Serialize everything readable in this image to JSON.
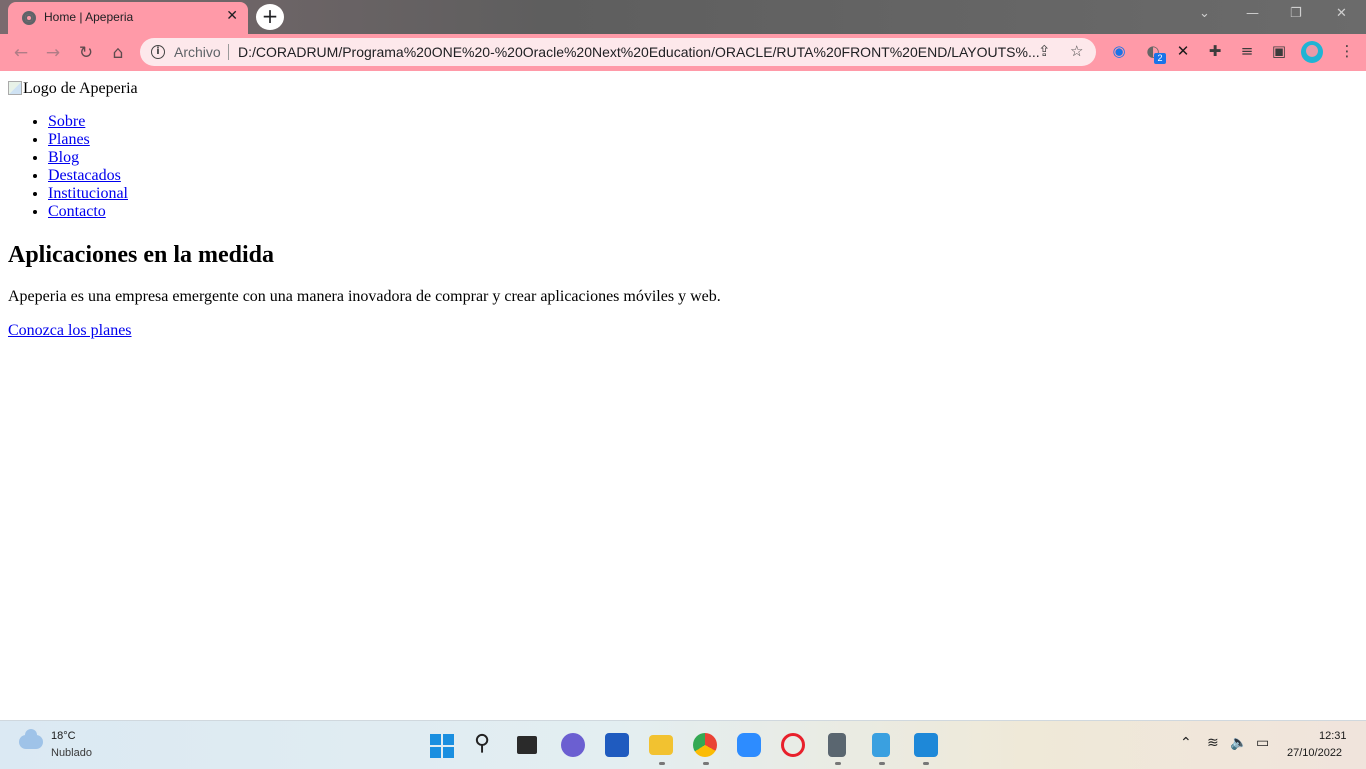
{
  "browser": {
    "tab_title": "Home | Apeperia",
    "new_tab_label": "+",
    "close_tab_label": "✕",
    "address": {
      "scheme_label": "Archivo",
      "url": "D:/CORADRUM/Programa%20ONE%20-%20Oracle%20Next%20Education/ORACLE/RUTA%20FRONT%20END/LAYOUTS%..."
    },
    "extensions_badge": "2",
    "colors": {
      "accent": "#ff9aa8",
      "link": "#0000ee"
    }
  },
  "page": {
    "logo_alt": "Logo de Apeperia",
    "nav_items": [
      {
        "label": "Sobre"
      },
      {
        "label": "Planes"
      },
      {
        "label": "Blog"
      },
      {
        "label": "Destacados"
      },
      {
        "label": "Institucional"
      },
      {
        "label": "Contacto"
      }
    ],
    "headline": "Aplicaciones en la medida",
    "description": "Apeperia es una empresa emergente con una manera inovadora de comprar y crear aplicaciones móviles y web.",
    "cta_label": "Conozca los planes"
  },
  "taskbar": {
    "weather": {
      "temperature": "18°C",
      "condition": "Nublado"
    },
    "clock": {
      "time": "12:31",
      "date": "27/10/2022"
    },
    "apps": [
      "windows-start",
      "search",
      "task-view",
      "teams-chat",
      "word",
      "file-explorer",
      "chrome",
      "zoom",
      "opera",
      "calculator",
      "notepad",
      "vscode"
    ]
  }
}
